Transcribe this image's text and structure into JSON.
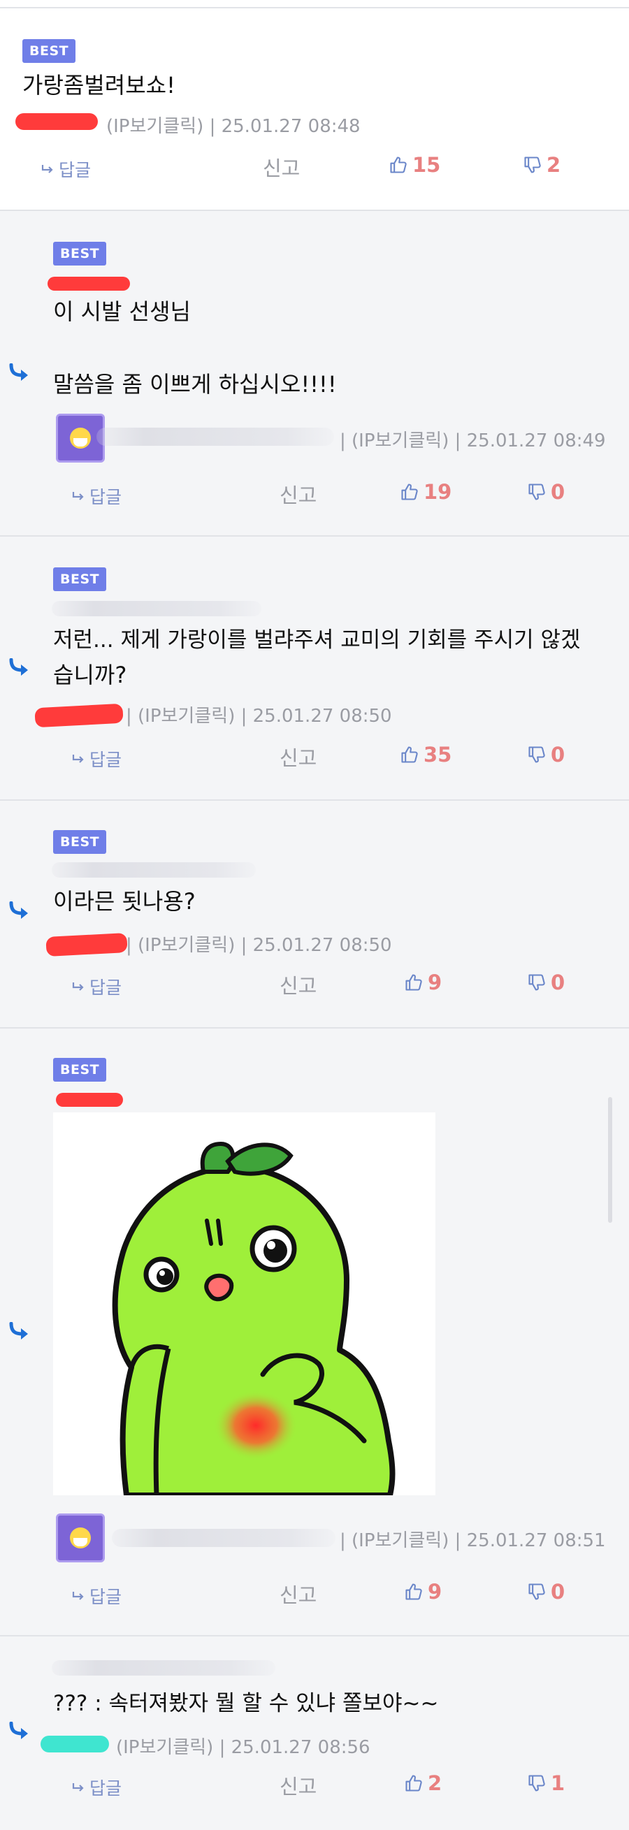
{
  "comments": [
    {
      "badge": "BEST",
      "text": "가랑좀벌려보쇼!",
      "meta": "(IP보기클릭) | 25.01.27 08:48",
      "reply_label": "답글",
      "report_label": "신고",
      "up": "15",
      "down": "2"
    },
    {
      "badge": "BEST",
      "text_line1": "이 시발 선생님",
      "text_line2": "말씀을 좀 이쁘게 하십시오!!!!",
      "meta": "| (IP보기클릭) | 25.01.27 08:49",
      "reply_label": "답글",
      "report_label": "신고",
      "up": "19",
      "down": "0"
    },
    {
      "badge": "BEST",
      "text_line1": "저런... 제게 가랑이를 벌랴주셔 교미의 기회를 주시기 않겠",
      "text_line2": "습니까?",
      "meta": "| (IP보기클릭) | 25.01.27 08:50",
      "reply_label": "답글",
      "report_label": "신고",
      "up": "35",
      "down": "0"
    },
    {
      "badge": "BEST",
      "text": "이라믄 됫나용?",
      "meta": "| (IP보기클릭) | 25.01.27 08:50",
      "reply_label": "답글",
      "report_label": "신고",
      "up": "9",
      "down": "0"
    },
    {
      "badge": "BEST",
      "meta": "| (IP보기클릭) | 25.01.27 08:51",
      "reply_label": "답글",
      "report_label": "신고",
      "up": "9",
      "down": "0"
    },
    {
      "text": "??? : 속터져봤자 뭘 할 수 있냐 쫄보야~~",
      "meta": "(IP보기클릭) | 25.01.27 08:56",
      "reply_label": "답글",
      "report_label": "신고",
      "up": "2",
      "down": "1"
    }
  ],
  "icons": {
    "reply_arrow": "reply-arrow-icon",
    "thumb_up": "thumbs-up-icon",
    "thumb_down": "thumbs-down-icon",
    "small_reply": "reply-small-icon"
  },
  "colors": {
    "badge": "#6f7ee8",
    "vote": "#e88080",
    "reply_action": "#7c8fc7",
    "arrow": "#1e6fd6"
  }
}
